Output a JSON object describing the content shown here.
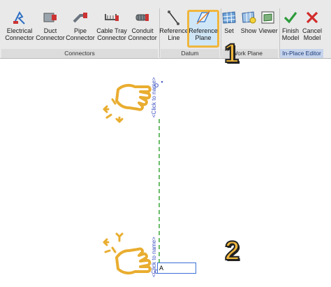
{
  "ribbon": {
    "tools": {
      "electrical_connector": [
        "Electrical",
        "Connector"
      ],
      "duct_connector": [
        "Duct",
        "Connector"
      ],
      "pipe_connector": [
        "Pipe",
        "Connector"
      ],
      "cable_tray_connector": [
        "Cable Tray",
        "Connector"
      ],
      "conduit_connector": [
        "Conduit",
        "Connector"
      ],
      "reference_line": [
        "Reference",
        "Line"
      ],
      "reference_plane": [
        "Reference",
        "Plane"
      ],
      "set": [
        "Set"
      ],
      "show": [
        "Show"
      ],
      "viewer": [
        "Viewer"
      ],
      "finish_model": [
        "Finish",
        "Model"
      ],
      "cancel_model": [
        "Cancel",
        "Model"
      ]
    },
    "panels": {
      "connectors": "Connectors",
      "datum": "Datum",
      "work_plane": "Work Plane",
      "in_place_editor": "In-Place Editor"
    }
  },
  "steps": {
    "one": "1",
    "two": "2"
  },
  "canvas": {
    "top_label": "<Click to name>",
    "bottom_label": "<Click to name>",
    "name_input_value": "A"
  },
  "colors": {
    "accent": "#f0b63c",
    "ref_plane_line": "#3aa63a",
    "ribbon_bg": "#e9e9e9",
    "highlight_fill": "#cfe6f7",
    "label_blue": "#3a4fc0"
  }
}
